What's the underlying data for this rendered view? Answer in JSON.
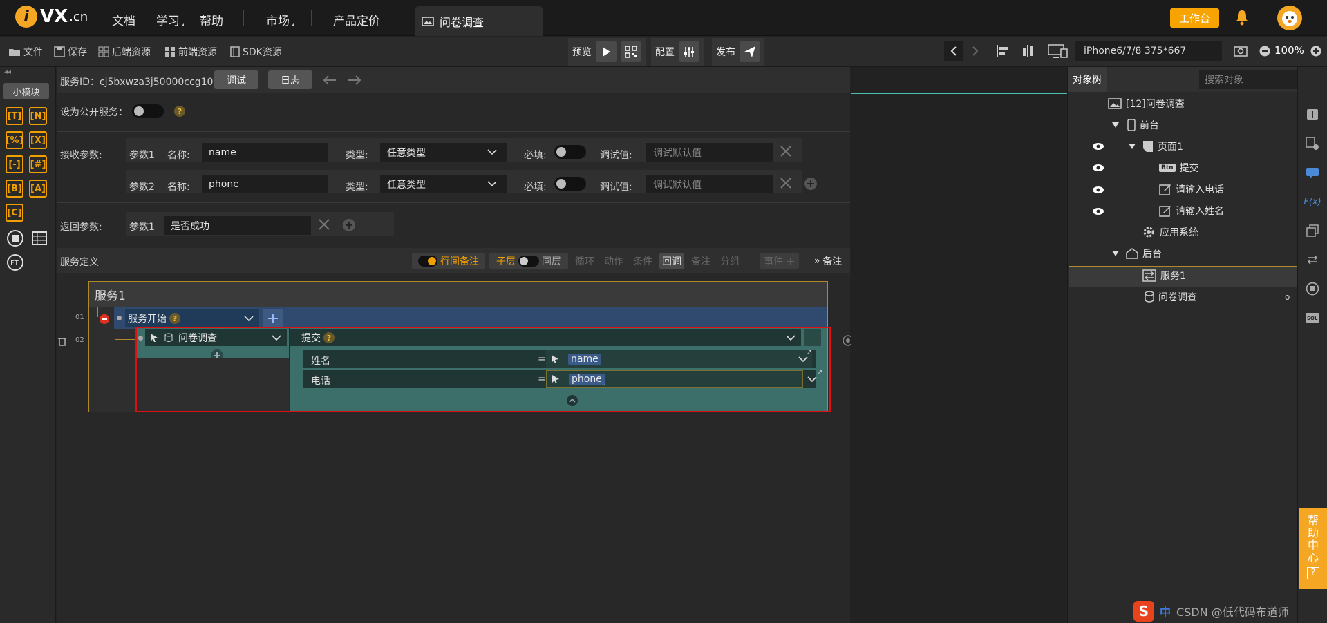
{
  "topbar": {
    "logo": "VX",
    "logo_suffix": ".cn",
    "logo_i": "i",
    "nav": [
      "文档",
      "学习",
      "帮助",
      "市场",
      "产品定价"
    ],
    "active_tab": "问卷调查",
    "workbench": "工作台"
  },
  "toolbar": {
    "file": "文件",
    "save": "保存",
    "backend": "后端资源",
    "frontend": "前端资源",
    "sdk": "SDK资源",
    "preview": "预览",
    "config": "配置",
    "publish": "发布",
    "device": "iPhone6/7/8 375*667",
    "zoom": "100%"
  },
  "left": {
    "mini": "小模块",
    "icons": [
      "[T]",
      "[N]",
      "[%]",
      "[X]",
      "[-]",
      "[#]",
      "[B]",
      "[A]",
      "[C]"
    ]
  },
  "service": {
    "id_label": "服务ID：",
    "id_value": "cj5bxwza3j50000ccg10",
    "debug": "调试",
    "log": "日志",
    "public_label": "设为公开服务：",
    "receive_label": "接收参数:",
    "return_label": "返回参数:",
    "params": [
      {
        "label": "参数1",
        "name_label": "名称:",
        "name": "name",
        "type_label": "类型:",
        "type": "任意类型",
        "required_label": "必填:",
        "debug_label": "调试值:",
        "debug_placeholder": "调试默认值"
      },
      {
        "label": "参数2",
        "name_label": "名称:",
        "name": "phone",
        "type_label": "类型:",
        "type": "任意类型",
        "required_label": "必填:",
        "debug_label": "调试值:",
        "debug_placeholder": "调试默认值"
      }
    ],
    "return_param": {
      "label": "参数1",
      "value": "是否成功"
    },
    "def_label": "服务定义",
    "chips": {
      "note": "行间备注",
      "sub": "子层",
      "same": "同层",
      "loop": "循环",
      "action": "动作",
      "cond": "条件",
      "callback": "回调",
      "remark": "备注",
      "group": "分组",
      "event": "事件",
      "notes": "备注"
    },
    "title": "服务1",
    "row01": {
      "num": "01",
      "label": "服务开始"
    },
    "row02": {
      "num": "02",
      "target": "问卷调查",
      "action": "提交",
      "fields": [
        {
          "label": "姓名",
          "eq": "=",
          "value": "name"
        },
        {
          "label": "电话",
          "eq": "=",
          "value": "phone"
        }
      ]
    }
  },
  "tree": {
    "tab": "对象树",
    "search_placeholder": "搜索对象",
    "items": [
      {
        "label": "[12]问卷调查"
      },
      {
        "label": "前台"
      },
      {
        "label": "页面1"
      },
      {
        "label": "提交",
        "badge": "Btn"
      },
      {
        "label": "请输入电话"
      },
      {
        "label": "请输入姓名"
      },
      {
        "label": "应用系统"
      },
      {
        "label": "后台"
      },
      {
        "label": "服务1"
      },
      {
        "label": "问卷调查"
      }
    ]
  },
  "help": [
    "帮",
    "助",
    "中",
    "心",
    "?"
  ],
  "watermark": {
    "s": "S",
    "zh": "中",
    "text": "CSDN @低代码布道师"
  }
}
